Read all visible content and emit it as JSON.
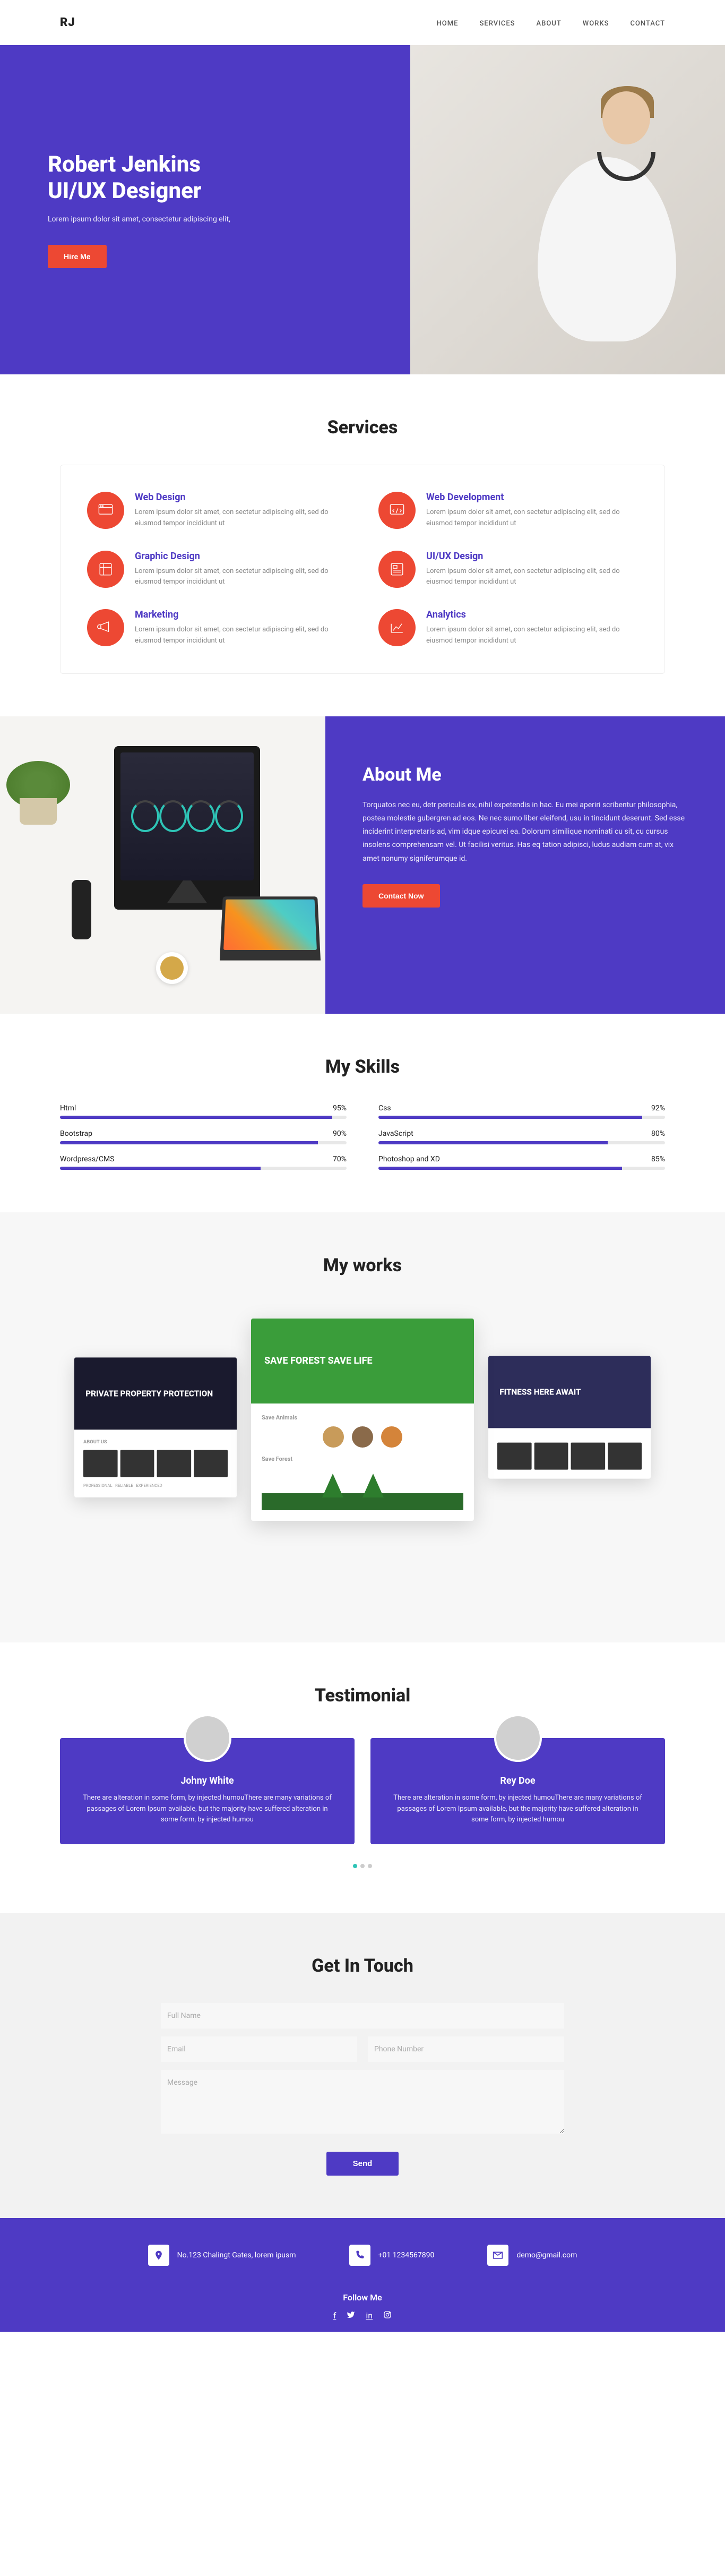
{
  "brand": "RJ",
  "nav": [
    "HOME",
    "SERVICES",
    "ABOUT",
    "WORKS",
    "CONTACT"
  ],
  "hero": {
    "title_line1": "Robert Jenkins",
    "title_line2": "UI/UX Designer",
    "subtitle": "Lorem ipsum dolor sit amet, consectetur adipiscing elit,",
    "cta": "Hire Me"
  },
  "services": {
    "title": "Services",
    "items": [
      {
        "name": "Web Design",
        "desc": "Lorem ipsum dolor sit amet, con sectetur adipiscing elit, sed do eiusmod tempor incididunt ut"
      },
      {
        "name": "Web Development",
        "desc": "Lorem ipsum dolor sit amet, con sectetur adipiscing elit, sed do eiusmod tempor incididunt ut"
      },
      {
        "name": "Graphic Design",
        "desc": "Lorem ipsum dolor sit amet, con sectetur adipiscing elit, sed do eiusmod tempor incididunt ut"
      },
      {
        "name": "UI/UX Design",
        "desc": "Lorem ipsum dolor sit amet, con sectetur adipiscing elit, sed do eiusmod tempor incididunt ut"
      },
      {
        "name": "Marketing",
        "desc": "Lorem ipsum dolor sit amet, con sectetur adipiscing elit, sed do eiusmod tempor incididunt ut"
      },
      {
        "name": "Analytics",
        "desc": "Lorem ipsum dolor sit amet, con sectetur adipiscing elit, sed do eiusmod tempor incididunt ut"
      }
    ]
  },
  "about": {
    "title": "About Me",
    "body": "Torquatos nec eu, detr periculis ex, nihil expetendis in hac. Eu mei aperiri scribentur philosophia, postea molestie gubergren ad eos. Ne nec sumo liber eleifend, usu in tincidunt deserunt. Sed esse inciderint interpretaris ad, vim idque epicurei ea. Dolorum similique nominati cu sit, cu cursus insolens comprehensam vel. Ut facilisi veritus. Has eq tation adipisci, ludus audiam cum at, vix amet nonumy signiferumque id.",
    "cta": "Contact Now"
  },
  "skills": {
    "title": "My Skills",
    "items": [
      {
        "name": "Html",
        "pct": 95
      },
      {
        "name": "Css",
        "pct": 92
      },
      {
        "name": "Bootstrap",
        "pct": 90
      },
      {
        "name": "JavaScript",
        "pct": 80
      },
      {
        "name": "Wordpress/CMS",
        "pct": 70
      },
      {
        "name": "Photoshop and XD",
        "pct": 85
      }
    ]
  },
  "works": {
    "title": "My works",
    "cards": [
      {
        "heading": "PRIVATE PROPERTY PROTECTION",
        "sub": "ABOUT US"
      },
      {
        "heading": "SAVE FOREST SAVE LIFE",
        "sub1": "Save Animals",
        "sub2": "Save Forest"
      },
      {
        "heading": "FITNESS HERE AWAIT"
      }
    ]
  },
  "testimonial": {
    "title": "Testimonial",
    "items": [
      {
        "name": "Johny White",
        "text": "There are alteration in some form, by injected humouThere are many variations of passages of Lorem Ipsum available, but the majority have suffered alteration in some form, by injected humou"
      },
      {
        "name": "Rey Doe",
        "text": "There are alteration in some form, by injected humouThere are many variations of passages of Lorem Ipsum available, but the majority have suffered alteration in some form, by injected humou"
      }
    ]
  },
  "contact": {
    "title": "Get In Touch",
    "ph_name": "Full Name",
    "ph_email": "Email",
    "ph_phone": "Phone Number",
    "ph_msg": "Message",
    "send": "Send"
  },
  "footer": {
    "address": "No.123 Chalingt Gates, lorem ipusm",
    "phone": "+01 1234567890",
    "email": "demo@gmail.com",
    "follow": "Follow Me"
  }
}
